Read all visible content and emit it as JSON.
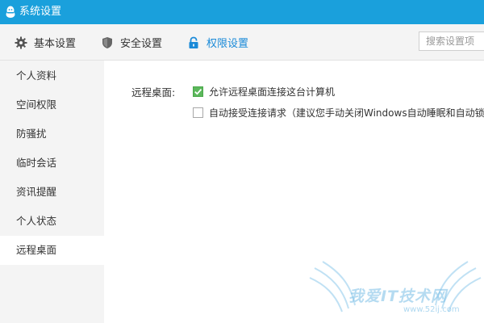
{
  "window": {
    "title": "系统设置",
    "titlebar_color": "#1aa0dc"
  },
  "toolbar": {
    "tabs": [
      {
        "label": "基本设置",
        "icon": "gear-icon",
        "active": false
      },
      {
        "label": "安全设置",
        "icon": "shield-icon",
        "active": false
      },
      {
        "label": "权限设置",
        "icon": "lock-icon",
        "active": true
      }
    ],
    "search": {
      "placeholder": "搜索设置项",
      "value": ""
    },
    "active_color": "#1a8ad8"
  },
  "sidebar": {
    "items": [
      {
        "label": "个人资料",
        "active": false
      },
      {
        "label": "空间权限",
        "active": false
      },
      {
        "label": "防骚扰",
        "active": false
      },
      {
        "label": "临时会话",
        "active": false
      },
      {
        "label": "资讯提醒",
        "active": false
      },
      {
        "label": "个人状态",
        "active": false
      },
      {
        "label": "远程桌面",
        "active": true
      }
    ]
  },
  "content": {
    "section_label": "远程桌面:",
    "options": [
      {
        "label": "允许远程桌面连接这台计算机",
        "checked": true
      },
      {
        "label": "自动接受连接请求（建议您手动关闭Windows自动睡眠和自动锁屏",
        "checked": false
      }
    ],
    "check_color": "#5cb85c"
  },
  "watermark": {
    "text": "我爱IT技术网",
    "url": "www.52ij.com"
  }
}
